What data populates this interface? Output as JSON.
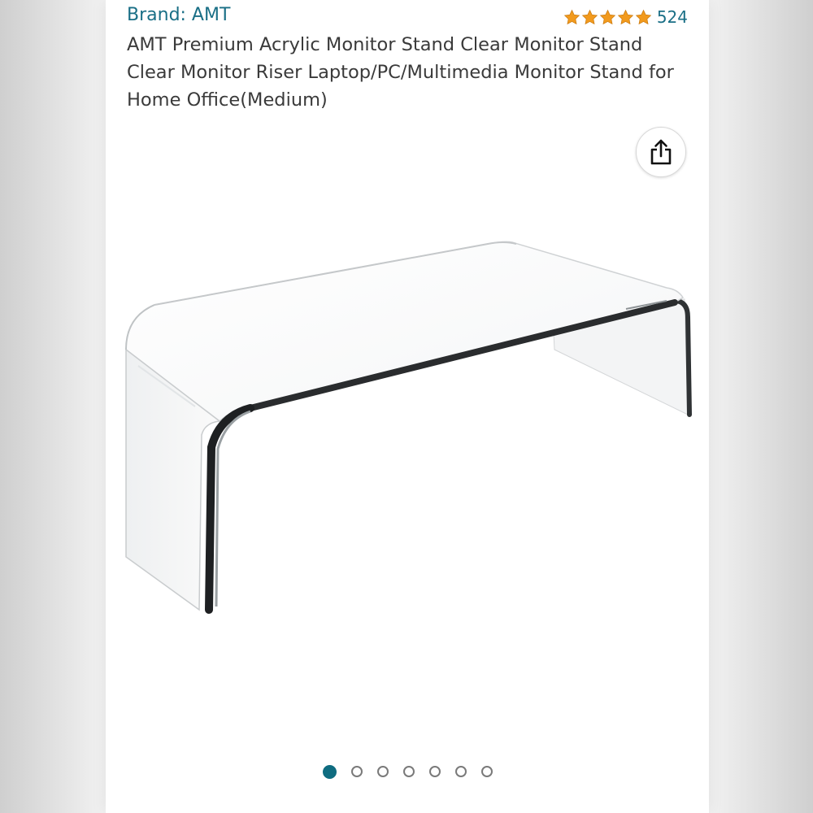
{
  "product": {
    "brand_label": "Brand: AMT",
    "title": "AMT Premium Acrylic Monitor Stand Clear Monitor Stand Clear Monitor Riser Laptop/PC/Multimedia Monitor Stand for Home Office(Medium)",
    "rating_value": 5,
    "rating_count": "524"
  },
  "gallery": {
    "total_images": 7,
    "active_index": 0
  },
  "icons": {
    "share": "share-icon",
    "star": "star-icon"
  },
  "colors": {
    "link": "#1a6f86",
    "star": "#f29a1d",
    "active_dot": "#0f6c80"
  }
}
